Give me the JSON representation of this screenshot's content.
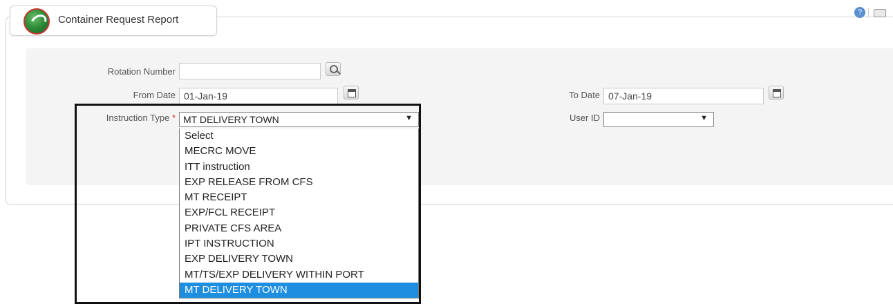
{
  "header": {
    "title": "Container Request Report"
  },
  "form": {
    "rotation_number": {
      "label": "Rotation Number",
      "value": ""
    },
    "from_date": {
      "label": "From Date",
      "value": "01-Jan-19"
    },
    "to_date": {
      "label": "To Date",
      "value": "07-Jan-19"
    },
    "instruction_type": {
      "label": "Instruction Type",
      "required_marker": "*",
      "selected": "MT DELIVERY TOWN"
    },
    "user_id": {
      "label": "User ID",
      "selected": ""
    }
  },
  "dropdown": {
    "options": [
      "Select",
      "MECRC MOVE",
      "ITT instruction",
      "EXP RELEASE FROM CFS",
      "MT RECEIPT",
      "EXP/FCL RECEIPT",
      "PRIVATE CFS AREA",
      "IPT INSTRUCTION",
      "EXP DELIVERY TOWN",
      "MT/TS/EXP DELIVERY WITHIN PORT",
      "MT DELIVERY TOWN"
    ],
    "highlighted_index": 10
  },
  "icons": {
    "arrow": "▼",
    "help": "?"
  },
  "colors": {
    "highlight": "#1e8fe0",
    "required": "#d9251d"
  }
}
